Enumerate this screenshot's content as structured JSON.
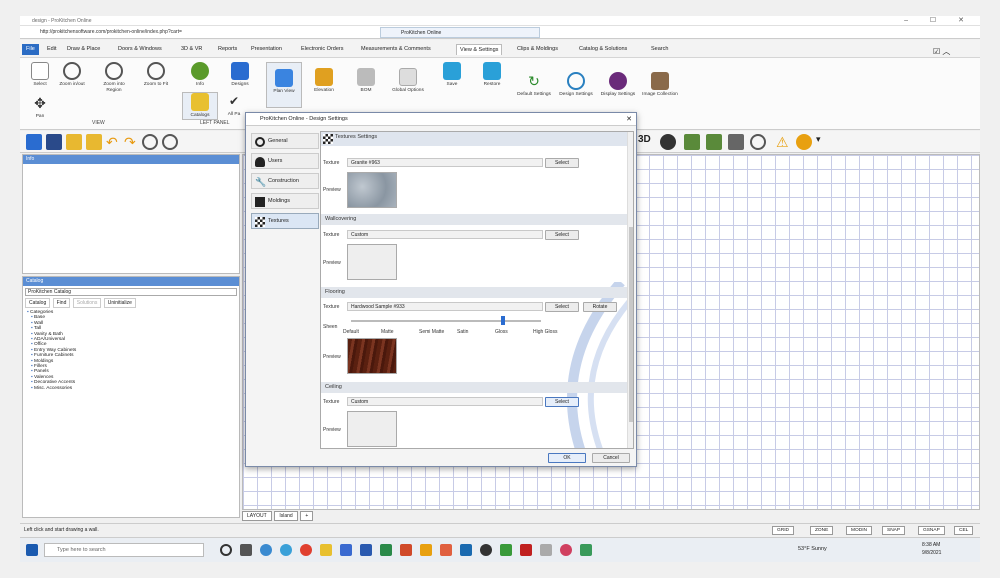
{
  "browser": {
    "window_title": "design - ProKitchen Online",
    "url": "http://prokitchensoftware.com/prokitchen-online/index.php?cart=",
    "tab_title": "ProKitchen Online",
    "controls": "–  ☐  ✕"
  },
  "menu": {
    "items": [
      "File",
      "Edit",
      "Draw & Place",
      "Doors & Windows",
      "3D & VR",
      "Reports",
      "Presentation",
      "Electronic Orders",
      "Measurements & Comments",
      "View & Settings",
      "Clips & Moldings",
      "Catalog & Solutions",
      "Search"
    ]
  },
  "ribbon": {
    "view_buttons": [
      "Select",
      "Zoom in/out",
      "Zoom into Region",
      "Zoom to Fit"
    ],
    "pan": "Pan",
    "left_buttons": [
      "Info",
      "Designs"
    ],
    "catalogs": "Catalogs",
    "all_panels": "All Pa",
    "view_group": "VIEW",
    "left_panel_group": "LEFT PANEL",
    "right_buttons": [
      "Plan View",
      "Elevation",
      "BOM",
      "Global Options",
      "Save",
      "Restore",
      "Default Settings",
      "Design Settings",
      "Display Settings",
      "Image Collection"
    ]
  },
  "info_panel": {
    "title": "Info"
  },
  "catalog_panel": {
    "title": "Catalog",
    "selected": "ProKitchen Catalog",
    "tabs": [
      "Catalog",
      "Find",
      "Solutions",
      "Uninitialize"
    ],
    "tree_root": "Categories",
    "tree_items": [
      "Base",
      "Wall",
      "Tall",
      "Vanity & Bath",
      "ADA/Universal",
      "Office",
      "Entry Way Cabinets",
      "Furniture Cabinets",
      "Moldings",
      "Fillers",
      "Panels",
      "Valences",
      "Decorative Accents",
      "Misc. Accessories"
    ]
  },
  "grid_tabs": [
    "LAYOUT",
    "Island",
    "+"
  ],
  "status": {
    "message": "Left click and start drawing a wall.",
    "buttons": [
      "GRID",
      "ZONE",
      "MODIN",
      "SNAP",
      "GSNAP",
      "CEL"
    ]
  },
  "taskbar": {
    "search_placeholder": "Type here to search",
    "weather": "53°F Sunny",
    "time": "8:38 AM",
    "date": "9/8/2021"
  },
  "dialog": {
    "title": "ProKitchen Online - Design Settings",
    "nav": [
      "General",
      "Users",
      "Construction",
      "Moldings",
      "Textures"
    ],
    "header": "Textures Settings",
    "texture_label": "Texture",
    "preview_label": "Preview",
    "select_label": "Select",
    "rotate_label": "Rotate",
    "top_texture": "Granite #963",
    "sections": [
      {
        "name": "Wallcovering",
        "texture": "Custom"
      },
      {
        "name": "Flooring",
        "texture": "Hardwood Sample #933"
      },
      {
        "name": "Ceiling",
        "texture": "Custom"
      }
    ],
    "sheen_label": "Sheen",
    "sheen_levels": [
      "Default",
      "Matte",
      "Semi Matte",
      "Satin",
      "Gloss",
      "High Gloss"
    ],
    "sheen_value": 4,
    "ok": "OK",
    "cancel": "Cancel"
  },
  "colors": {
    "accent": "#2b6cc4",
    "granite": "#9aa6b0",
    "wood": "#6b2a1a",
    "grid": "#c7cbe6"
  }
}
